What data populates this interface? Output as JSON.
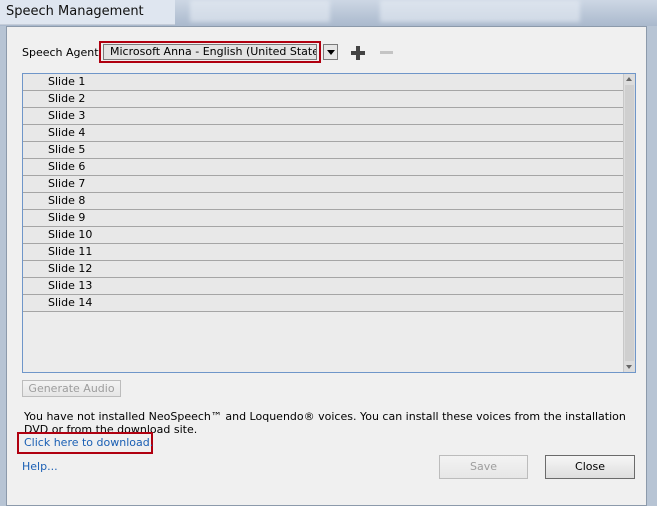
{
  "window": {
    "title": "Speech Management"
  },
  "agent": {
    "label": "Speech Agent",
    "selected": "Microsoft Anna - English (United States)"
  },
  "toolbar": {
    "add_icon": "plus-icon",
    "remove_icon": "minus-icon"
  },
  "slides": [
    "Slide 1",
    "Slide 2",
    "Slide 3",
    "Slide 4",
    "Slide 5",
    "Slide 6",
    "Slide 7",
    "Slide 8",
    "Slide 9",
    "Slide 10",
    "Slide 11",
    "Slide 12",
    "Slide 13",
    "Slide 14"
  ],
  "buttons": {
    "generate": "Generate Audio",
    "save": "Save",
    "close": "Close"
  },
  "info": {
    "text": "You have not installed NeoSpeech™ and Loquendo® voices. You can install these voices from the installation DVD or from the download site.",
    "link": "Click here to download."
  },
  "help": "Help...",
  "colors": {
    "highlight": "#b00010",
    "link": "#1a5fb4",
    "list_border": "#6f96c9"
  }
}
